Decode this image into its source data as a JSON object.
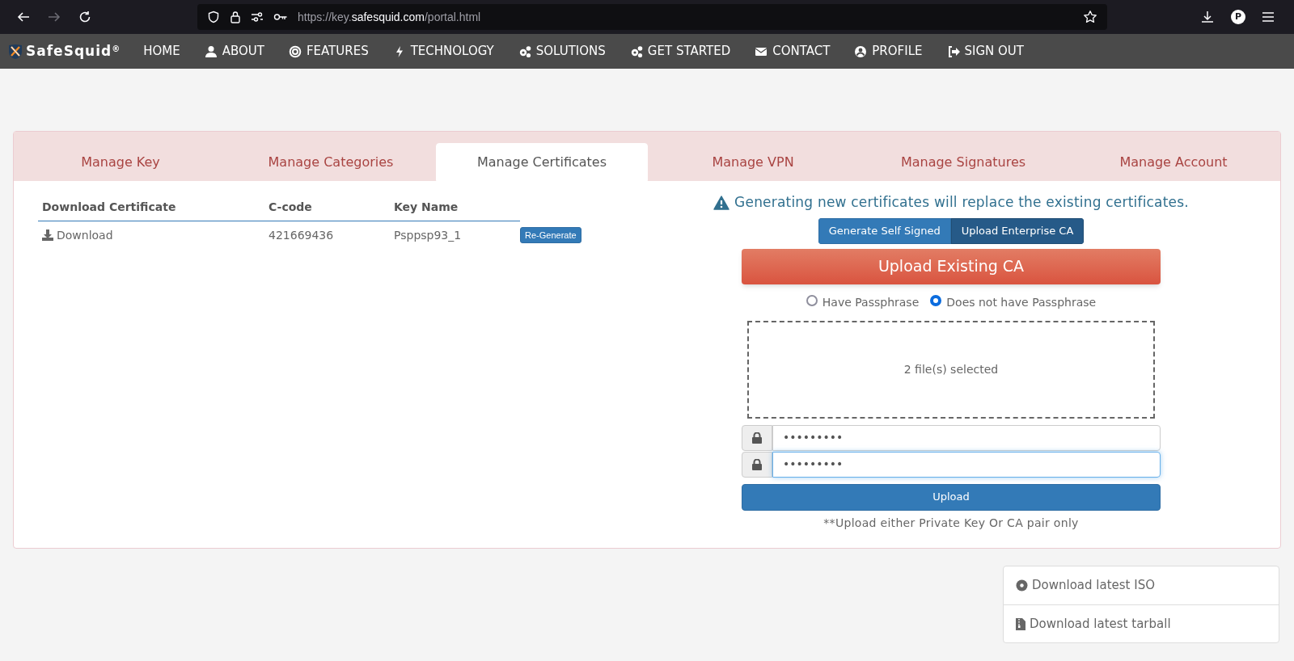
{
  "browser": {
    "url": {
      "prefix": "https://key.",
      "domain": "safesquid.com",
      "suffix": "/portal.html"
    },
    "forward_disabled": true,
    "profile_initial": "P"
  },
  "navbar": {
    "brand": "SafeSquid",
    "brand_mark": "®",
    "items": [
      {
        "label": "HOME",
        "kind": "plain"
      },
      {
        "label": "ABOUT",
        "kind": "user"
      },
      {
        "label": "FEATURES",
        "kind": "target"
      },
      {
        "label": "TECHNOLOGY",
        "kind": "bolt"
      },
      {
        "label": "SOLUTIONS",
        "kind": "gears"
      },
      {
        "label": "GET STARTED",
        "kind": "gears"
      },
      {
        "label": "CONTACT",
        "kind": "envelope"
      },
      {
        "label": "PROFILE",
        "kind": "profile"
      },
      {
        "label": "SIGN OUT",
        "kind": "signout"
      }
    ]
  },
  "tabs": [
    {
      "label": "Manage Key",
      "selected": false
    },
    {
      "label": "Manage Categories",
      "selected": false
    },
    {
      "label": "Manage Certificates",
      "selected": true
    },
    {
      "label": "Manage VPN",
      "selected": false
    },
    {
      "label": "Manage Signatures",
      "selected": false
    },
    {
      "label": "Manage Account",
      "selected": false
    }
  ],
  "table": {
    "columns": [
      "Download Certificate",
      "C-code",
      "Key Name"
    ],
    "rows": [
      {
        "download": "Download",
        "c_code": "421669436",
        "key_name": "Psppsp93_1",
        "action": "Re-Generate"
      }
    ]
  },
  "upload_panel": {
    "warning": "Generating new certificates will replace the existing certificates.",
    "modes": [
      {
        "label": "Generate Self Signed",
        "selected": false
      },
      {
        "label": "Upload Enterprise CA",
        "selected": true
      }
    ],
    "heading": "Upload Existing CA",
    "passphrase_options": [
      {
        "label": "Have Passphrase",
        "selected": false
      },
      {
        "label": "Does not have Passphrase",
        "selected": true
      }
    ],
    "dropzone": "2 file(s) selected",
    "fields": [
      {
        "value": "•••••••••",
        "focused": false
      },
      {
        "value": "•••••••••",
        "focused": true
      }
    ],
    "upload_button": "Upload",
    "note": "**Upload either Private Key Or CA pair only"
  },
  "downloads": [
    {
      "label": "Download latest ISO",
      "kind": "disc"
    },
    {
      "label": "Download latest tarball",
      "kind": "file"
    }
  ]
}
